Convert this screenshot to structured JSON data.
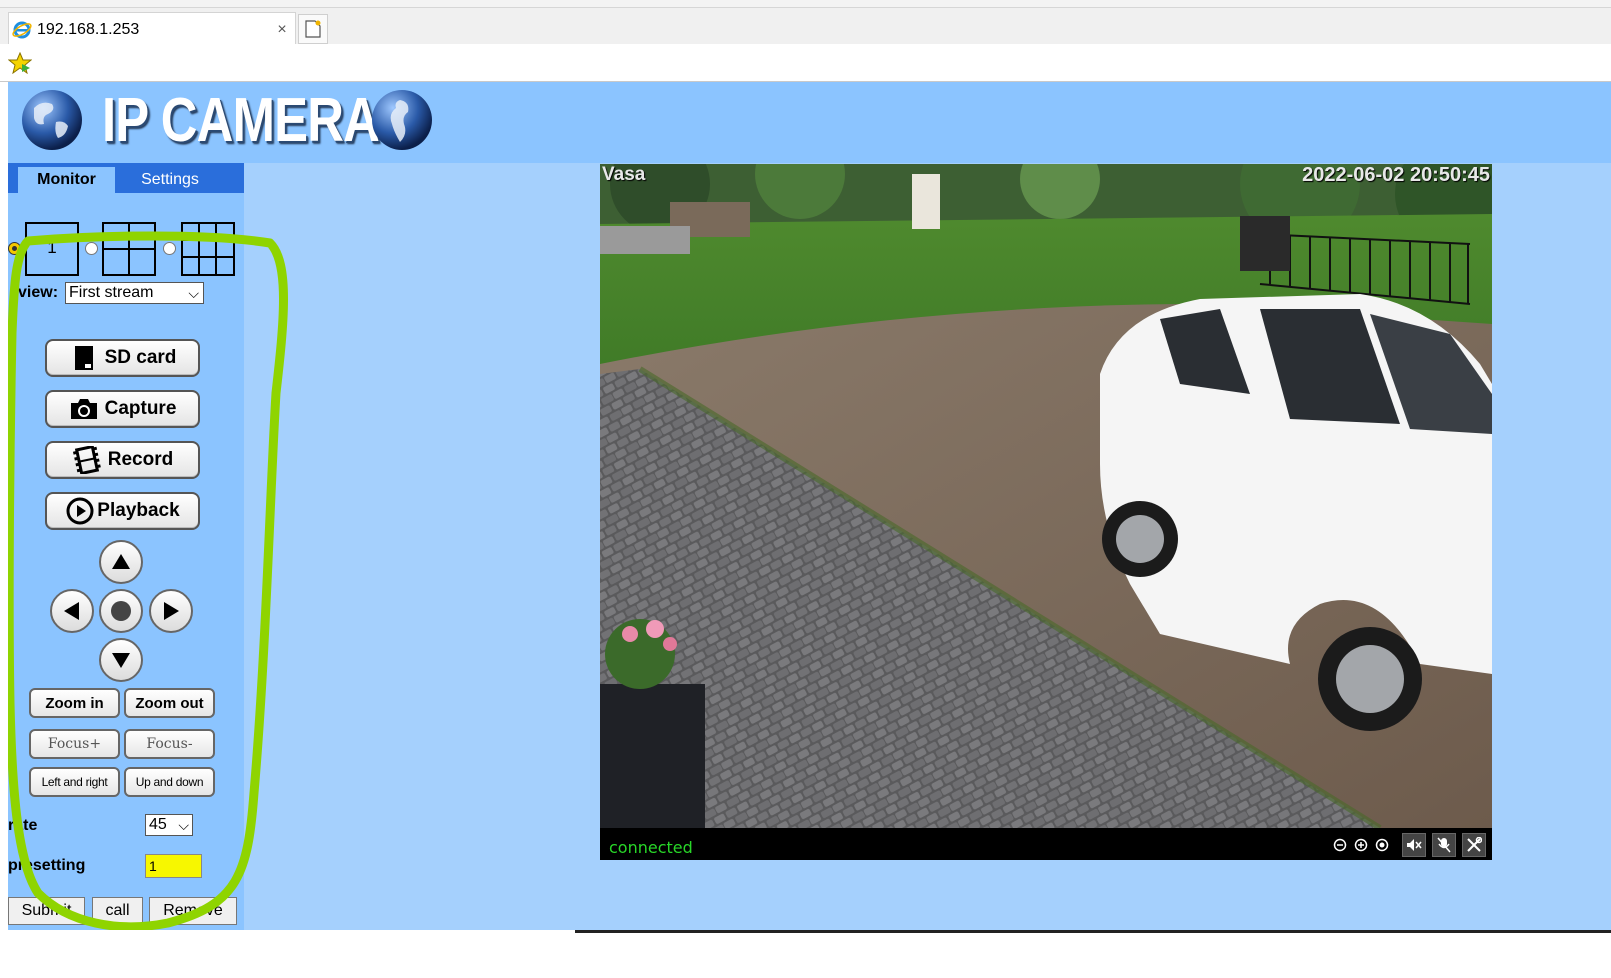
{
  "browser": {
    "tab_title": "192.168.1.253",
    "close_glyph": "×"
  },
  "header": {
    "logo_text": "IP CAMERA"
  },
  "tabs": {
    "monitor": "Monitor",
    "settings": "Settings"
  },
  "layout": {
    "single_label": "1",
    "selected": "single"
  },
  "view": {
    "label": "view:",
    "value": "First stream"
  },
  "buttons": {
    "sd_card": "SD card",
    "capture": "Capture",
    "record": "Record",
    "playback": "Playback",
    "zoom_in": "Zoom in",
    "zoom_out": "Zoom out",
    "focus_plus": "Focus+",
    "focus_minus": "Focus-",
    "left_right": "Left and right",
    "up_down": "Up and down"
  },
  "rate": {
    "label": "rate",
    "value": "45"
  },
  "preset": {
    "label": "presetting",
    "value": "1"
  },
  "form": {
    "submit": "Submit",
    "call": "call",
    "remove": "Remove"
  },
  "video": {
    "camera_name": "Vasa",
    "timestamp": "2022-06-02 20:50:45",
    "status": "connected"
  },
  "colors": {
    "page_bg": "#a5d0fd",
    "panel_bg": "#8bc4ff",
    "tab_active_bg": "#2a6edb",
    "annotation_green": "#8fd400",
    "status_green": "#28d728"
  }
}
